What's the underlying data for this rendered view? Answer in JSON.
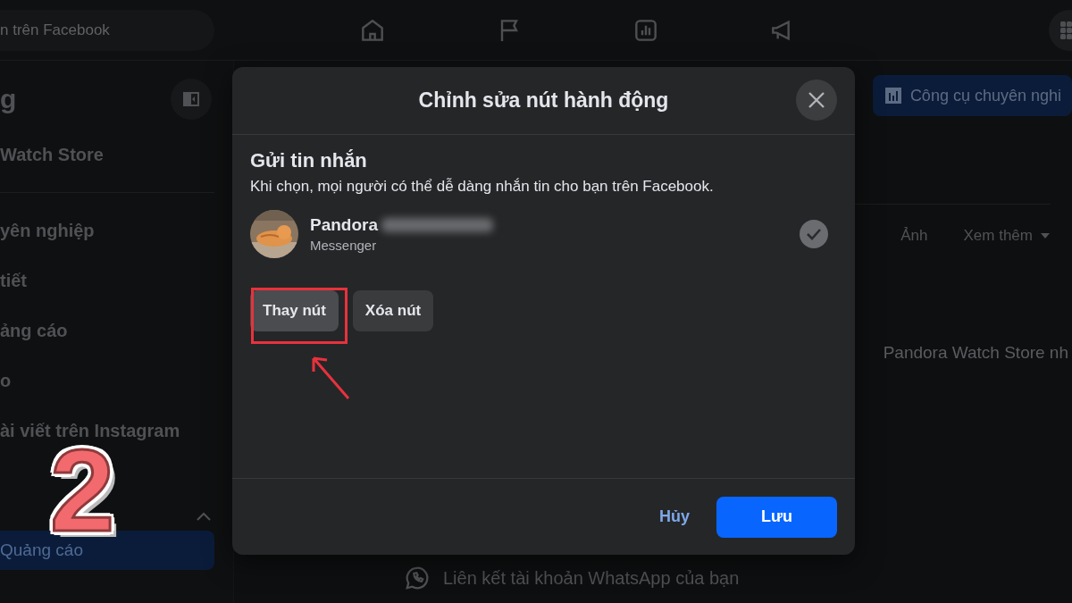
{
  "top_bar": {
    "search": {
      "placeholder": "n trên Facebook"
    },
    "nav": [
      {
        "kind": "home",
        "selected": false
      },
      {
        "kind": "flag",
        "selected": false
      },
      {
        "kind": "chart",
        "selected": false
      },
      {
        "kind": "megaphone",
        "selected": false
      }
    ]
  },
  "sidebar": {
    "title": "g",
    "page_name": "Watch Store",
    "items": [
      {
        "label": "yên nghiệp",
        "selected": false
      },
      {
        "label": "tiết",
        "selected": false
      },
      {
        "label": "ảng cáo",
        "selected": false
      },
      {
        "label": "o",
        "selected": false
      },
      {
        "label": "ài viết trên Instagram",
        "selected": false
      }
    ],
    "section_item": {
      "label": "Quảng cáo",
      "selected": true
    }
  },
  "main": {
    "pro_tools_button": "Công cụ chuyên nghi",
    "tabs": [
      {
        "label": "Ảnh",
        "selected": false
      },
      {
        "label": "Xem thêm",
        "selected": false
      }
    ],
    "notice": "Pandora Watch Store nh",
    "whatsapp_link": "Liên kết tài khoản WhatsApp của bạn"
  },
  "dialog": {
    "title": "Chỉnh sửa nút hành động",
    "heading": "Gửi tin nhắn",
    "description": "Khi chọn, mọi người có thể dễ dàng nhắn tin cho bạn trên Facebook.",
    "option": {
      "name": "Pandora",
      "subtitle": "Messenger",
      "checked": true
    },
    "actions": [
      "Thay nút",
      "Xóa nút"
    ],
    "cancel": "Hủy",
    "save": "Lưu"
  },
  "annotation": {
    "step": "2"
  }
}
